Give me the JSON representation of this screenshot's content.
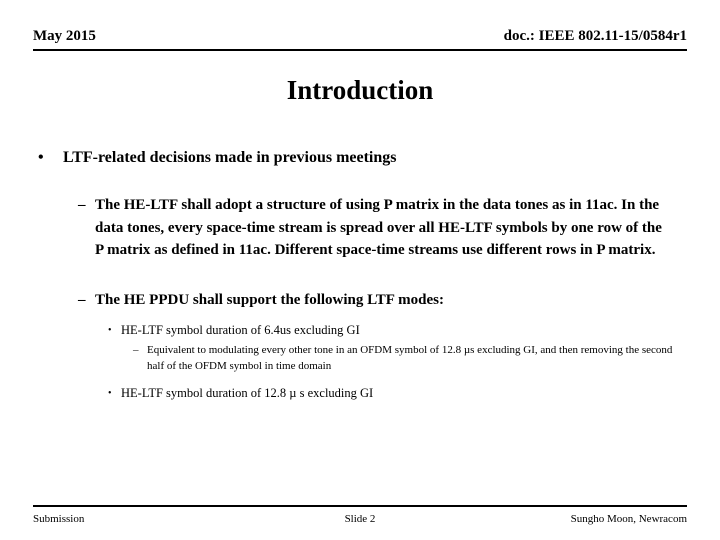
{
  "header": {
    "left": "May 2015",
    "right": "doc.: IEEE 802.11-15/0584r1"
  },
  "title": "Introduction",
  "bullets": {
    "l1_marker": "•",
    "l2_marker": "–",
    "l3_marker": "•",
    "l4_marker": "–",
    "item1": "LTF-related decisions made in previous meetings",
    "item2": "The HE-LTF shall adopt a structure of using P matrix in the data tones as in 11ac. In the data tones, every space-time stream is spread over all HE-LTF symbols by one row of the P matrix as defined in 11ac. Different space-time streams use different rows in P matrix.",
    "item3": "The HE PPDU shall support the following LTF modes:",
    "item4": "HE-LTF symbol duration of 6.4us excluding GI",
    "item5": "Equivalent to modulating every other tone in an OFDM symbol of 12.8 µs excluding GI, and then removing the second half of the OFDM symbol in time domain",
    "item6": "HE-LTF symbol duration of 12.8 µ s excluding GI"
  },
  "footer": {
    "left": "Submission",
    "center": "Slide 2",
    "right": "Sungho Moon, Newracom"
  }
}
